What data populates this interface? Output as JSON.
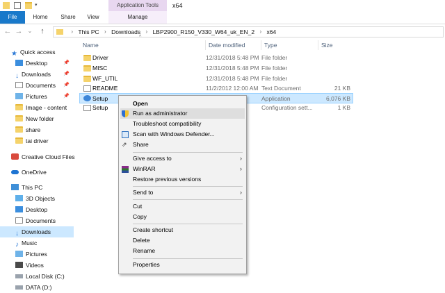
{
  "window": {
    "title": "x64",
    "contextual_tab_group": "Application Tools"
  },
  "ribbon": {
    "tabs": [
      "File",
      "Home",
      "Share",
      "View",
      "Manage"
    ]
  },
  "address": {
    "crumbs": [
      "This PC",
      "Downloads",
      "LBP2900_R150_V330_W64_uk_EN_2",
      "x64"
    ]
  },
  "columns": {
    "name": "Name",
    "date": "Date modified",
    "type": "Type",
    "size": "Size"
  },
  "sidebar": {
    "items": [
      {
        "label": "Quick access"
      },
      {
        "label": "Desktop"
      },
      {
        "label": "Downloads"
      },
      {
        "label": "Documents"
      },
      {
        "label": "Pictures"
      },
      {
        "label": "Image - content"
      },
      {
        "label": "New folder"
      },
      {
        "label": "share"
      },
      {
        "label": "tai driver"
      },
      {
        "label": "Creative Cloud Files"
      },
      {
        "label": "OneDrive"
      },
      {
        "label": "This PC"
      },
      {
        "label": "3D Objects"
      },
      {
        "label": "Desktop"
      },
      {
        "label": "Documents"
      },
      {
        "label": "Downloads"
      },
      {
        "label": "Music"
      },
      {
        "label": "Pictures"
      },
      {
        "label": "Videos"
      },
      {
        "label": "Local Disk (C:)"
      },
      {
        "label": "DATA (D:)"
      }
    ]
  },
  "files": [
    {
      "name": "Driver",
      "date": "12/31/2018 5:48 PM",
      "type": "File folder",
      "size": ""
    },
    {
      "name": "MISC",
      "date": "12/31/2018 5:48 PM",
      "type": "File folder",
      "size": ""
    },
    {
      "name": "WF_UTIL",
      "date": "12/31/2018 5:48 PM",
      "type": "File folder",
      "size": ""
    },
    {
      "name": "README",
      "date": "11/2/2012 12:00 AM",
      "type": "Text Document",
      "size": "21 KB"
    },
    {
      "name": "Setup",
      "date": "",
      "type": "Application",
      "size": "6,076 KB"
    },
    {
      "name": "Setup",
      "date": "",
      "type": "Configuration sett...",
      "size": "1 KB"
    }
  ],
  "context_menu": {
    "items": [
      "Open",
      "Run as administrator",
      "Troubleshoot compatibility",
      "Scan with Windows Defender...",
      "Share",
      "Give access to",
      "WinRAR",
      "Restore previous versions",
      "Send to",
      "Cut",
      "Copy",
      "Create shortcut",
      "Delete",
      "Rename",
      "Properties"
    ]
  },
  "colors": {
    "accent": "#1979ca",
    "selection": "#cce8ff",
    "folder": "#f5d36b",
    "manage_tab": "#e8d7f0"
  }
}
